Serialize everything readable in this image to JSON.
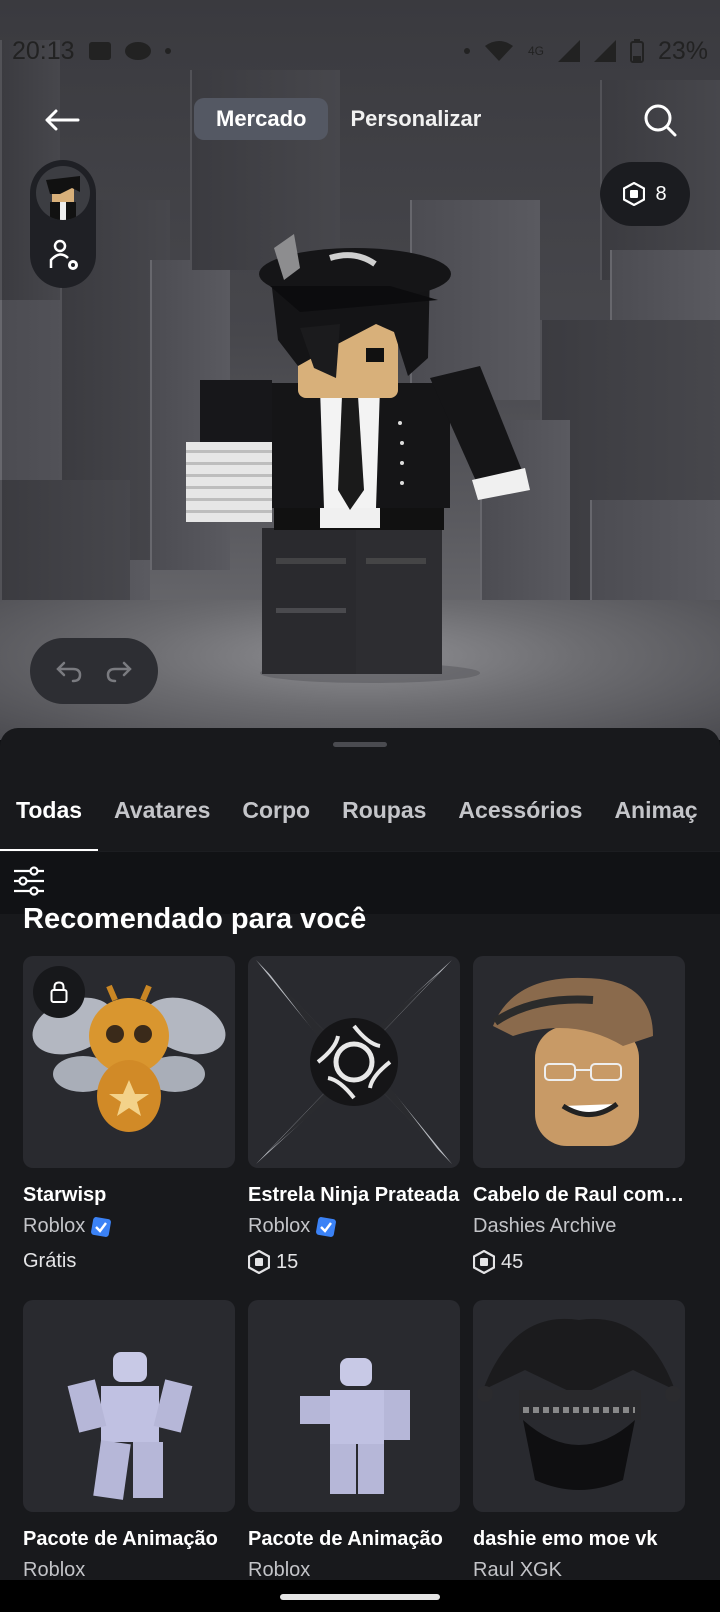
{
  "status_bar": {
    "time": "20:13",
    "battery": "23%",
    "network": "4G"
  },
  "header": {
    "tabs": [
      {
        "label": "Mercado",
        "active": true
      },
      {
        "label": "Personalizar",
        "active": false
      }
    ]
  },
  "robux_balance": "8",
  "categories": [
    {
      "label": "Todas",
      "active": true
    },
    {
      "label": "Avatares",
      "active": false
    },
    {
      "label": "Corpo",
      "active": false
    },
    {
      "label": "Roupas",
      "active": false
    },
    {
      "label": "Acessórios",
      "active": false
    },
    {
      "label": "Animaç",
      "active": false
    }
  ],
  "section_title": "Recomendado para você",
  "items": [
    {
      "name": "Starwisp",
      "creator": "Roblox",
      "verified": true,
      "price": "Grátis",
      "locked": true
    },
    {
      "name": "Estrela Ninja Prateada",
      "creator": "Roblox",
      "verified": true,
      "price": "15"
    },
    {
      "name": "Cabelo de Raul com Óculos",
      "creator": "Dashies Archive",
      "verified": false,
      "price": "45"
    },
    {
      "name": "Pacote de Animação",
      "creator": "Roblox",
      "verified": true
    },
    {
      "name": "Pacote de Animação",
      "creator": "Roblox",
      "verified": true
    },
    {
      "name": "dashie emo moe vk",
      "creator": "Raul XGK",
      "verified": false
    }
  ],
  "colors": {
    "sheet_bg": "#18191c",
    "verified": "#3b82f6",
    "active_tab": "#545863"
  }
}
